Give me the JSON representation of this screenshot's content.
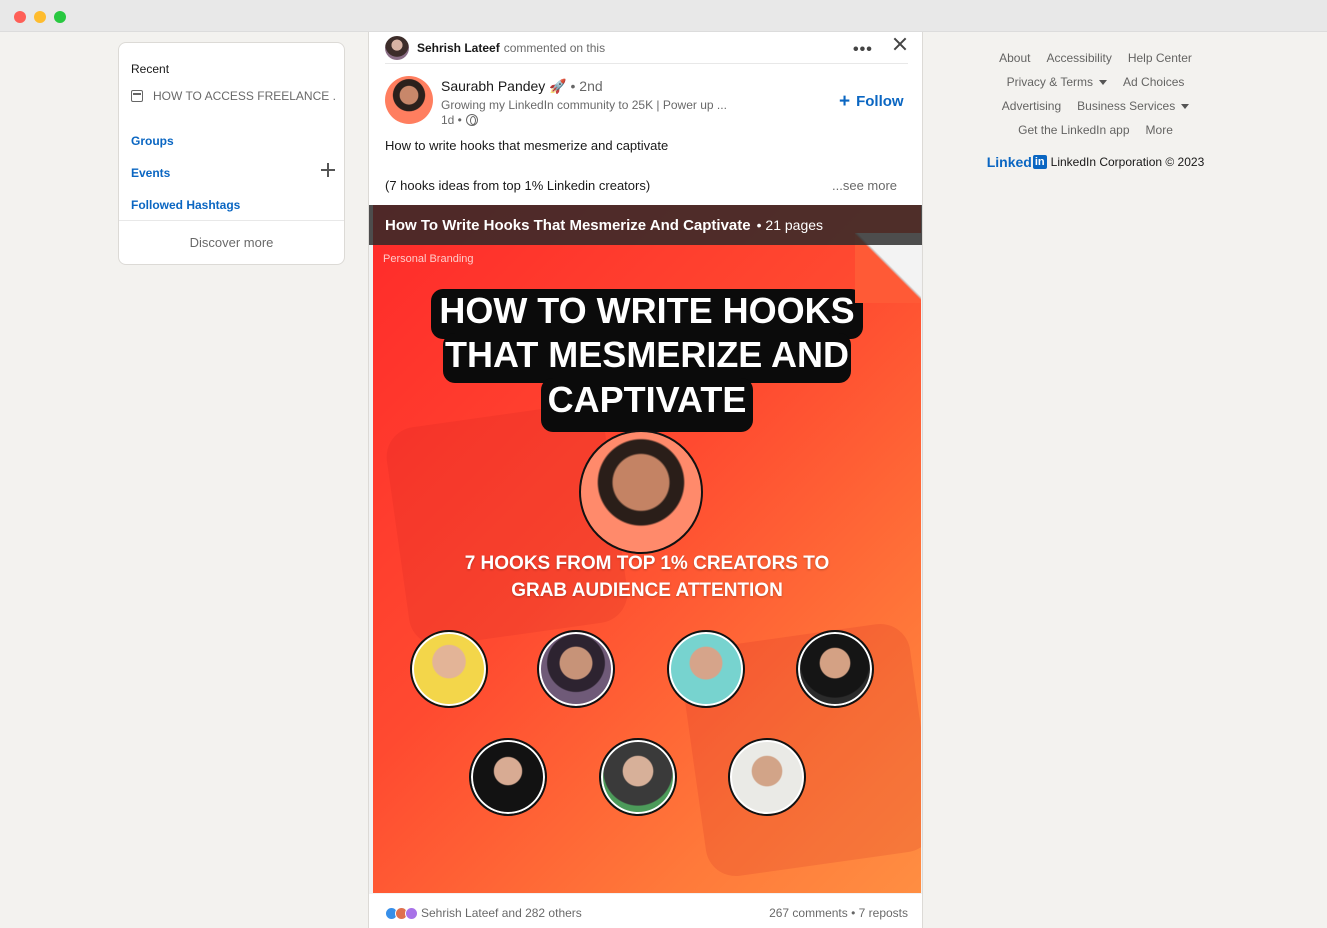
{
  "sidebar": {
    "recent_title": "Recent",
    "recent_item": "HOW TO ACCESS FREELANCE ...",
    "groups": "Groups",
    "events": "Events",
    "hashtags": "Followed Hashtags",
    "discover": "Discover more"
  },
  "post": {
    "context_name": "Sehrish Lateef",
    "context_rest": "commented on this",
    "more_glyph": "•••",
    "author_name": "Saurabh Pandey 🚀",
    "author_degree": " • 2nd",
    "author_headline": "Growing my LinkedIn community to 25K | Power up ...",
    "author_time": "1d •",
    "follow_label": "Follow",
    "text_line1": "How to write hooks that mesmerize and captivate",
    "text_line2": "(7 hooks ideas from top 1% Linkedin creators)",
    "see_more": "...see more",
    "document": {
      "title": "How To Write Hooks That Mesmerize And Captivate",
      "pages": "• 21 pages",
      "tag": "Personal Branding",
      "headline_1": "HOW TO WRITE HOOKS",
      "headline_2": "THAT MESMERIZE AND",
      "headline_3": "CAPTIVATE",
      "subtitle_1": "7 HOOKS FROM TOP 1% CREATORS TO",
      "subtitle_2": "GRAB AUDIENCE ATTENTION"
    },
    "reactions_text": "Sehrish Lateef and 282 others",
    "counts_text": "267 comments • 7 reposts"
  },
  "footer": {
    "about": "About",
    "accessibility": "Accessibility",
    "help": "Help Center",
    "privacy": "Privacy & Terms",
    "ad_choices": "Ad Choices",
    "advertising": "Advertising",
    "business": "Business Services",
    "app": "Get the LinkedIn app",
    "more": "More",
    "logo_text": "Linked",
    "logo_box": "in",
    "copyright": "LinkedIn Corporation © 2023"
  },
  "colors": {
    "accent": "#0a66c2",
    "slide_red": "#ff2a2a",
    "slide_orange": "#ff8e42"
  }
}
